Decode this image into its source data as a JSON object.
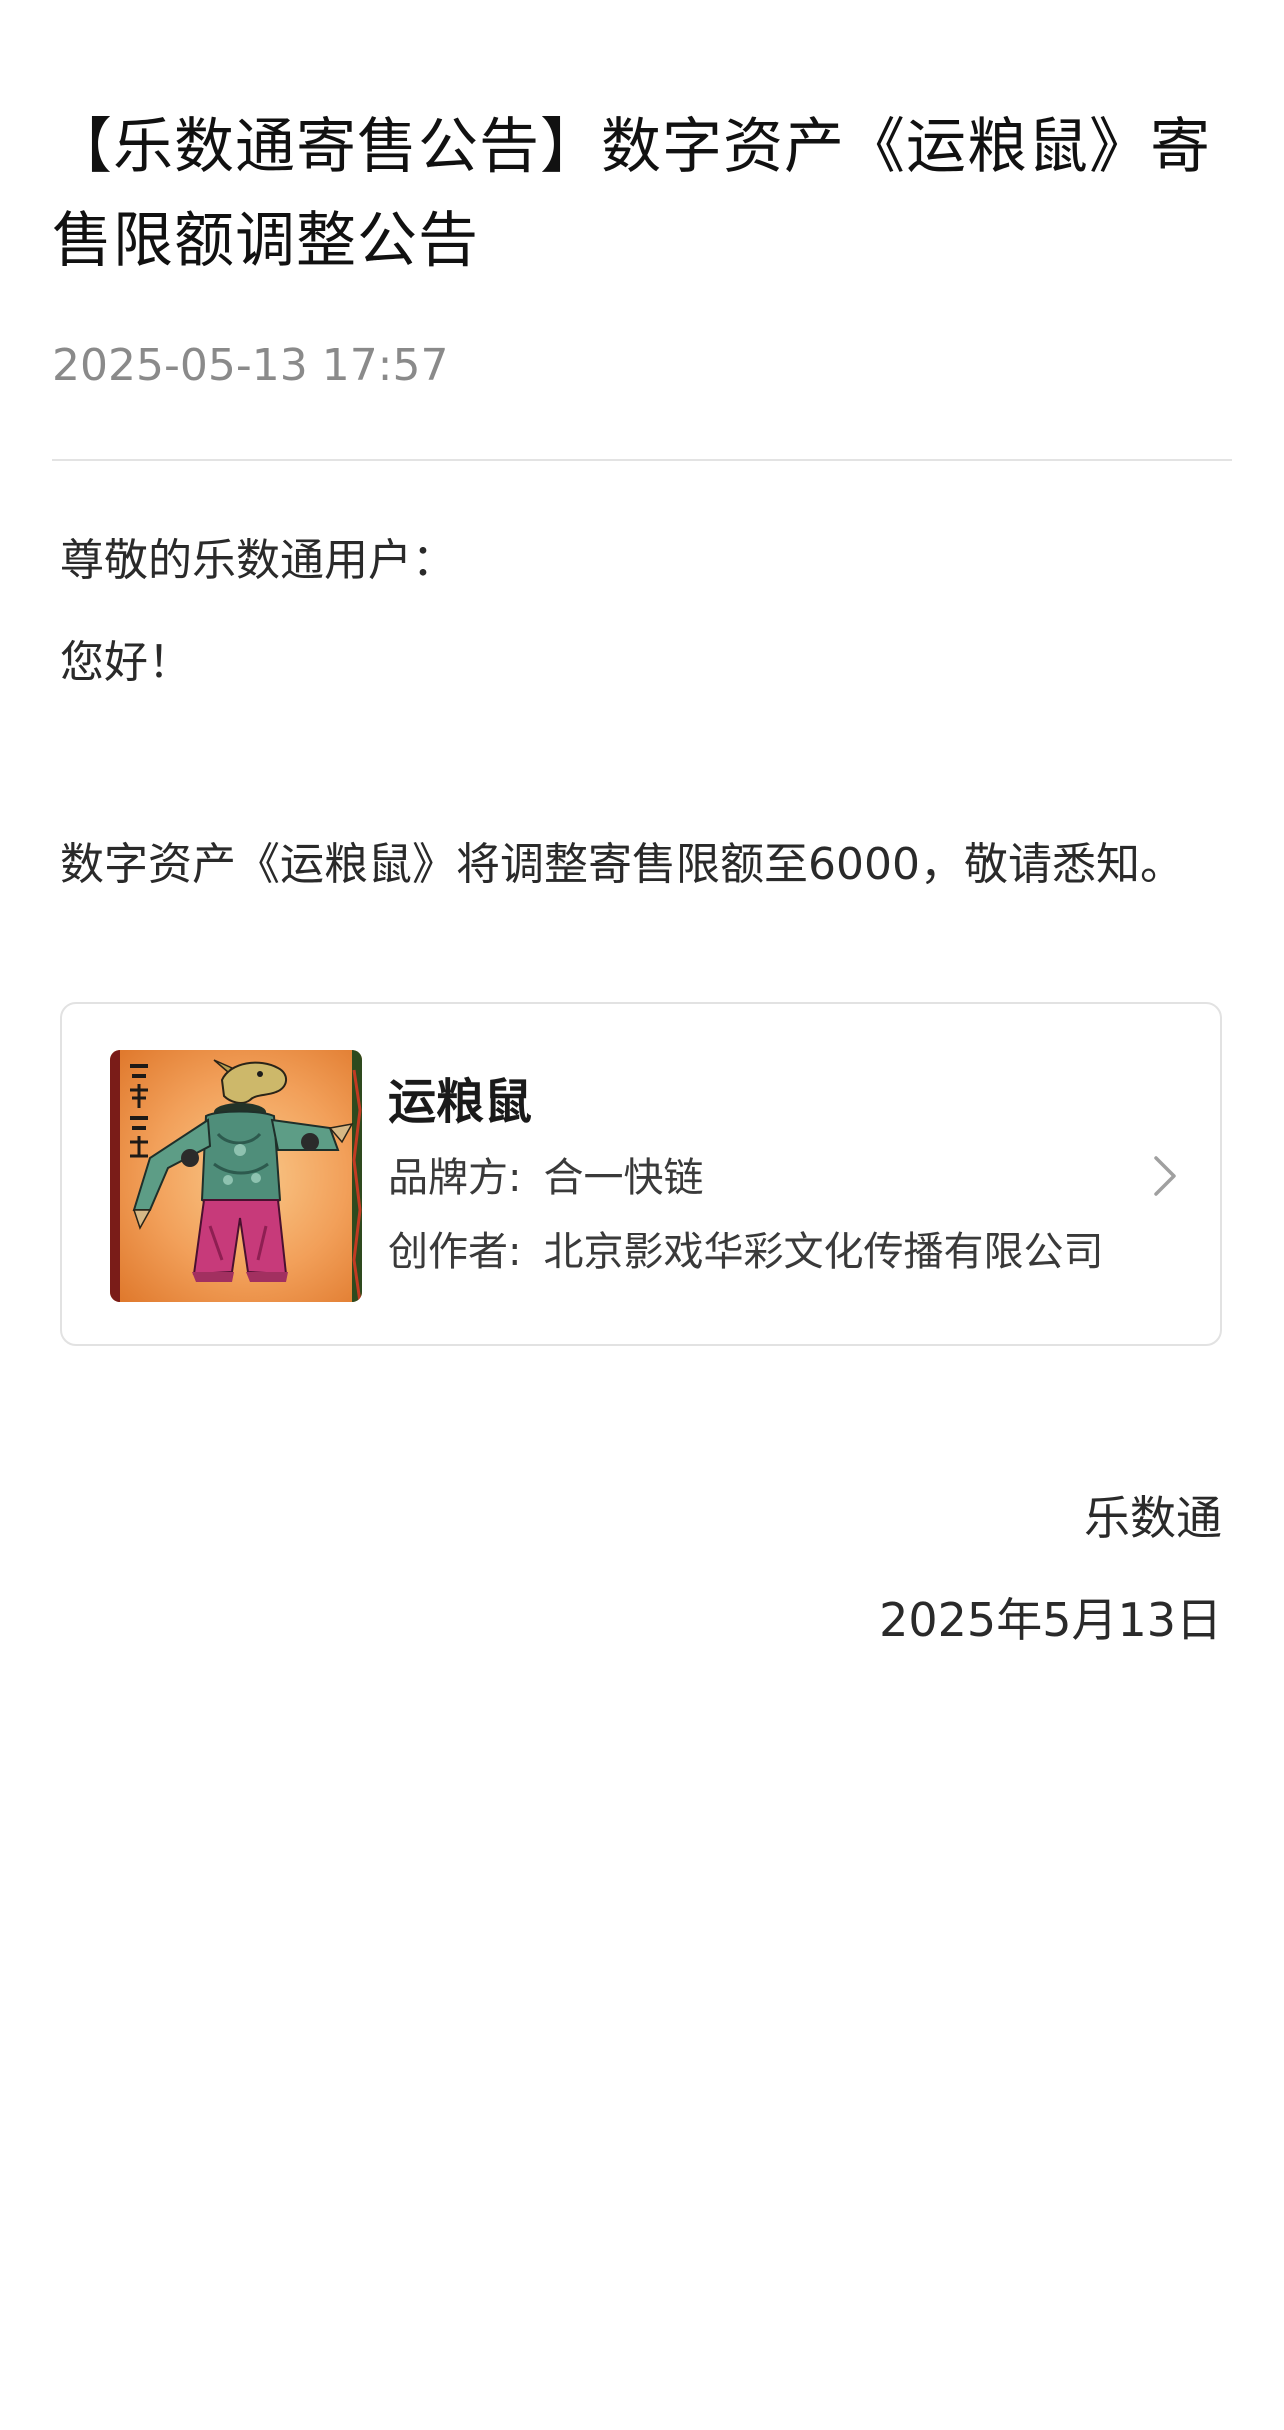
{
  "article": {
    "title": "【乐数通寄售公告】数字资产《运粮鼠》寄售限额调整公告",
    "timestamp": "2025-05-13 17:57"
  },
  "body": {
    "greeting": "尊敬的乐数通用户：",
    "hello": "您好！",
    "content": "数字资产《运粮鼠》将调整寄售限额至6000，敬请悉知。"
  },
  "asset_card": {
    "name": "运粮鼠",
    "brand_label": "品牌方:",
    "brand_value": "合一快链",
    "creator_label": "创作者:",
    "creator_value": "北京影戏华彩文化传播有限公司",
    "image_icon": "shadow-puppet-artwork",
    "image_caption_chars": "二零二五",
    "chevron_icon": "chevron-right-icon"
  },
  "signature": {
    "name": "乐数通",
    "date": "2025年5月13日"
  },
  "colors": {
    "text": "#1f1f1f",
    "muted": "#8a8a8a",
    "divider": "#e3e3e3",
    "card_border": "#e2e2e2"
  }
}
